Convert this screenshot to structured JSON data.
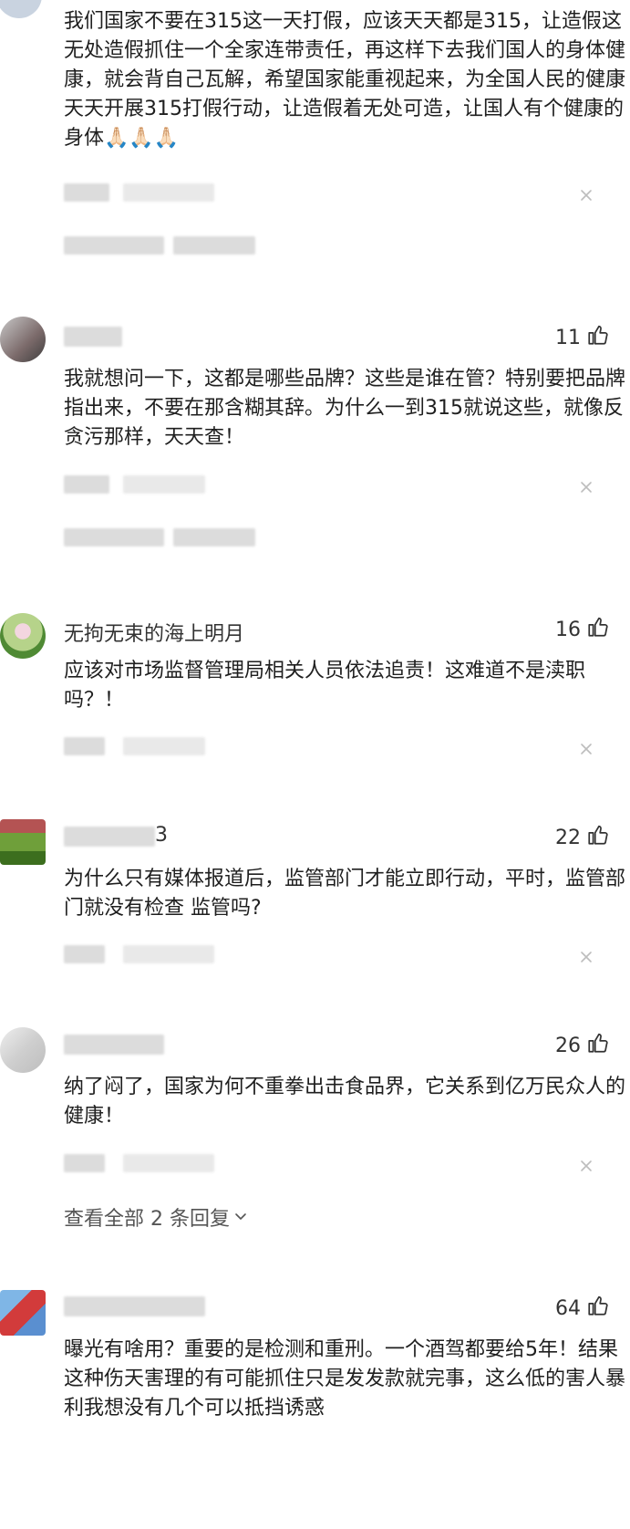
{
  "comments": [
    {
      "user": "",
      "likes": "",
      "text": "我们国家不要在315这一天打假，应该天天都是315，让造假这无处造假抓住一个全家连带责任，再这样下去我们国人的身体健康，就会背自己瓦解，希望国家能重视起来，为全国人民的健康天天开展315打假行动，让造假着无处可造，让国人有个健康的身体🙏🏻🙏🏻🙏🏻"
    },
    {
      "user": "",
      "likes": "11",
      "text": "我就想问一下，这都是哪些品牌？这些是谁在管？特别要把品牌指出来，不要在那含糊其辞。为什么一到315就说这些，就像反贪污那样，天天查！"
    },
    {
      "user": "无拘无束的海上明月",
      "likes": "16",
      "text": "应该对市场监督管理局相关人员依法追责！这难道不是渎职吗？！"
    },
    {
      "user": "3",
      "likes": "22",
      "text": "为什么只有媒体报道后，监管部门才能立即行动，平时，监管部门就没有检查 监管吗?"
    },
    {
      "user": "",
      "likes": "26",
      "text": "纳了闷了，国家为何不重拳出击食品界，它关系到亿万民众人的健康！",
      "view_replies": "查看全部 2 条回复"
    },
    {
      "user": "",
      "likes": "64",
      "text": "曝光有啥用？重要的是检测和重刑。一个酒驾都要给5年！结果这种伤天害理的有可能抓住只是发发款就完事，这么低的害人暴利我想没有几个可以抵挡诱惑"
    }
  ],
  "icons": {
    "like": "thumbs-up-icon",
    "close": "close-icon",
    "chevron": "chevron-down-icon"
  }
}
